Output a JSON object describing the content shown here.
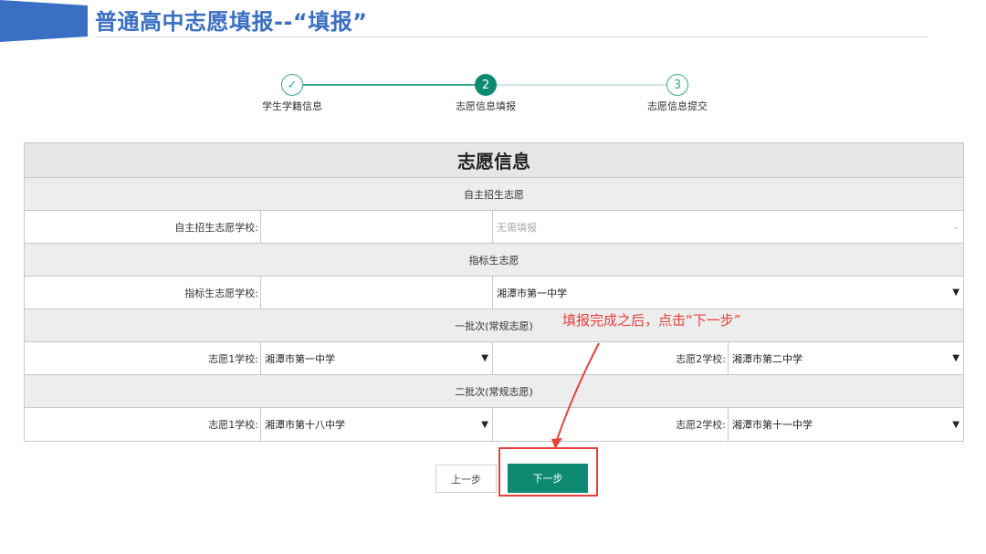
{
  "slide": {
    "title": "普通高中志愿填报--“填报”",
    "accent_color": "#3a6fc4"
  },
  "stepper": {
    "steps": [
      {
        "marker": "✓",
        "label": "学生学籍信息",
        "state": "done"
      },
      {
        "marker": "2",
        "label": "志愿信息填报",
        "state": "active"
      },
      {
        "marker": "3",
        "label": "志愿信息提交",
        "state": "todo"
      }
    ],
    "active_color": "#0f8a72"
  },
  "form": {
    "title": "志愿信息",
    "self_enrollment": {
      "section_title": "自主招生志愿",
      "school_label": "自主招生志愿学校:",
      "school_value": "无需填报"
    },
    "quota": {
      "section_title": "指标生志愿",
      "school_label": "指标生志愿学校:",
      "school_value": "湘潭市第一中学"
    },
    "batch1": {
      "section_title": "一批次(常规志愿)",
      "choice1_label": "志愿1学校:",
      "choice1_value": "湘潭市第一中学",
      "choice2_label": "志愿2学校:",
      "choice2_value": "湘潭市第二中学"
    },
    "batch2": {
      "section_title": "二批次(常规志愿)",
      "choice1_label": "志愿1学校:",
      "choice1_value": "湘潭市第十八中学",
      "choice2_label": "志愿2学校:",
      "choice2_value": "湘潭市第十一中学"
    }
  },
  "annotation": {
    "text": "填报完成之后，点击“下一步”",
    "color": "#e8413c"
  },
  "buttons": {
    "prev_label": "上一步",
    "next_label": "下一步"
  },
  "icons": {
    "dropdown": "chevron-down-icon",
    "done_step": "check-icon"
  }
}
